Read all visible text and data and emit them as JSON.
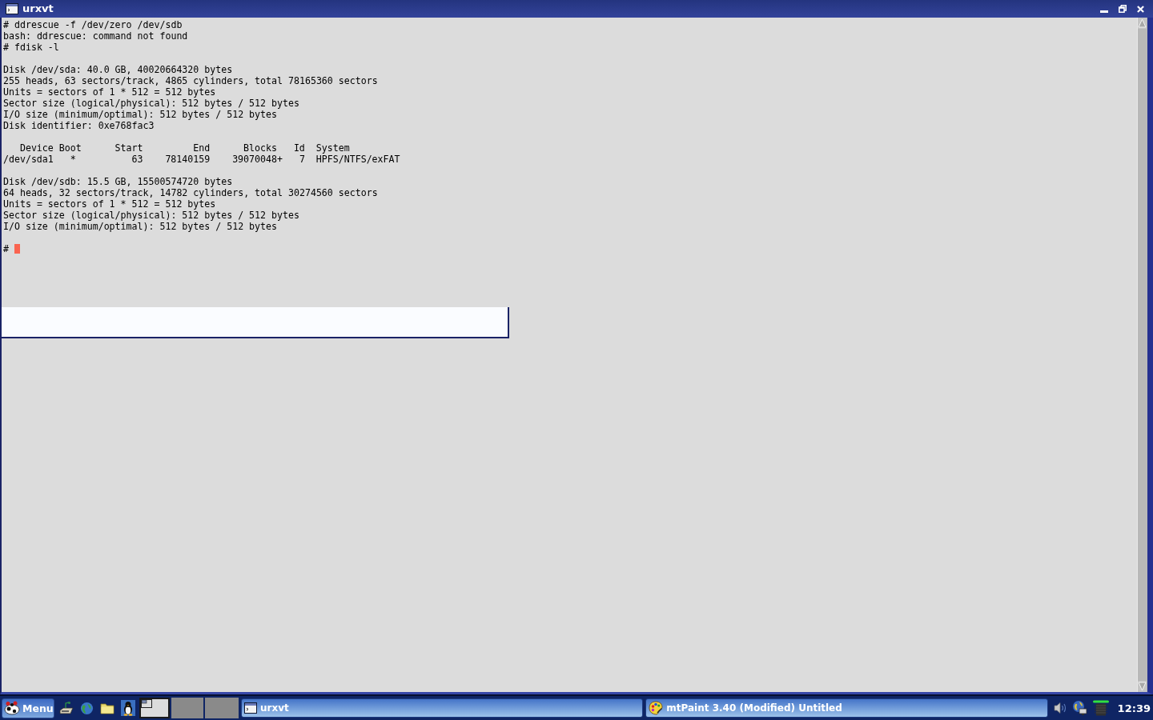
{
  "window": {
    "title": "urxvt",
    "terminal": {
      "output": [
        {
          "kind": "text",
          "lines": [
            "# ddrescue -f /dev/zero /dev/sdb",
            "bash: ddrescue: command not found",
            "# fdisk -l"
          ]
        },
        {
          "kind": "text",
          "lines": [
            "Disk /dev/sda: 40.0 GB, 40020664320 bytes",
            "255 heads, 63 sectors/track, 4865 cylinders, total 78165360 sectors",
            "Units = sectors of 1 * 512 = 512 bytes",
            "Sector size (logical/physical): 512 bytes / 512 bytes",
            "I/O size (minimum/optimal): 512 bytes / 512 bytes",
            "Disk identifier: 0xe768fac3"
          ]
        },
        {
          "kind": "table",
          "columns": [
            "Device",
            "Boot",
            "Start",
            "End",
            "Blocks",
            "Id",
            "System"
          ],
          "rows": [
            [
              "/dev/sda1",
              "*",
              "63",
              "78140159",
              "39070048+",
              "7",
              "HPFS/NTFS/exFAT"
            ]
          ]
        },
        {
          "kind": "text",
          "lines": [
            "Disk /dev/sdb: 15.5 GB, 15500574720 bytes",
            "64 heads, 32 sectors/track, 14782 cylinders, total 30274560 sectors",
            "Units = sectors of 1 * 512 = 512 bytes",
            "Sector size (logical/physical): 512 bytes / 512 bytes",
            "I/O size (minimum/optimal): 512 bytes / 512 bytes"
          ]
        }
      ],
      "prompt": {
        "text": "#",
        "cursor": true
      }
    }
  },
  "taskbar": {
    "menu_button": {
      "label": "Menu"
    },
    "pager": [
      {
        "selected": true
      },
      {
        "selected": false
      },
      {
        "selected": false
      }
    ],
    "tasks": [
      {
        "kind": "terminal",
        "label": "urxvt"
      },
      {
        "kind": "paint",
        "label": "mtPaint 3.40 (Modified) Untitled"
      }
    ],
    "clock": "12:39"
  }
}
